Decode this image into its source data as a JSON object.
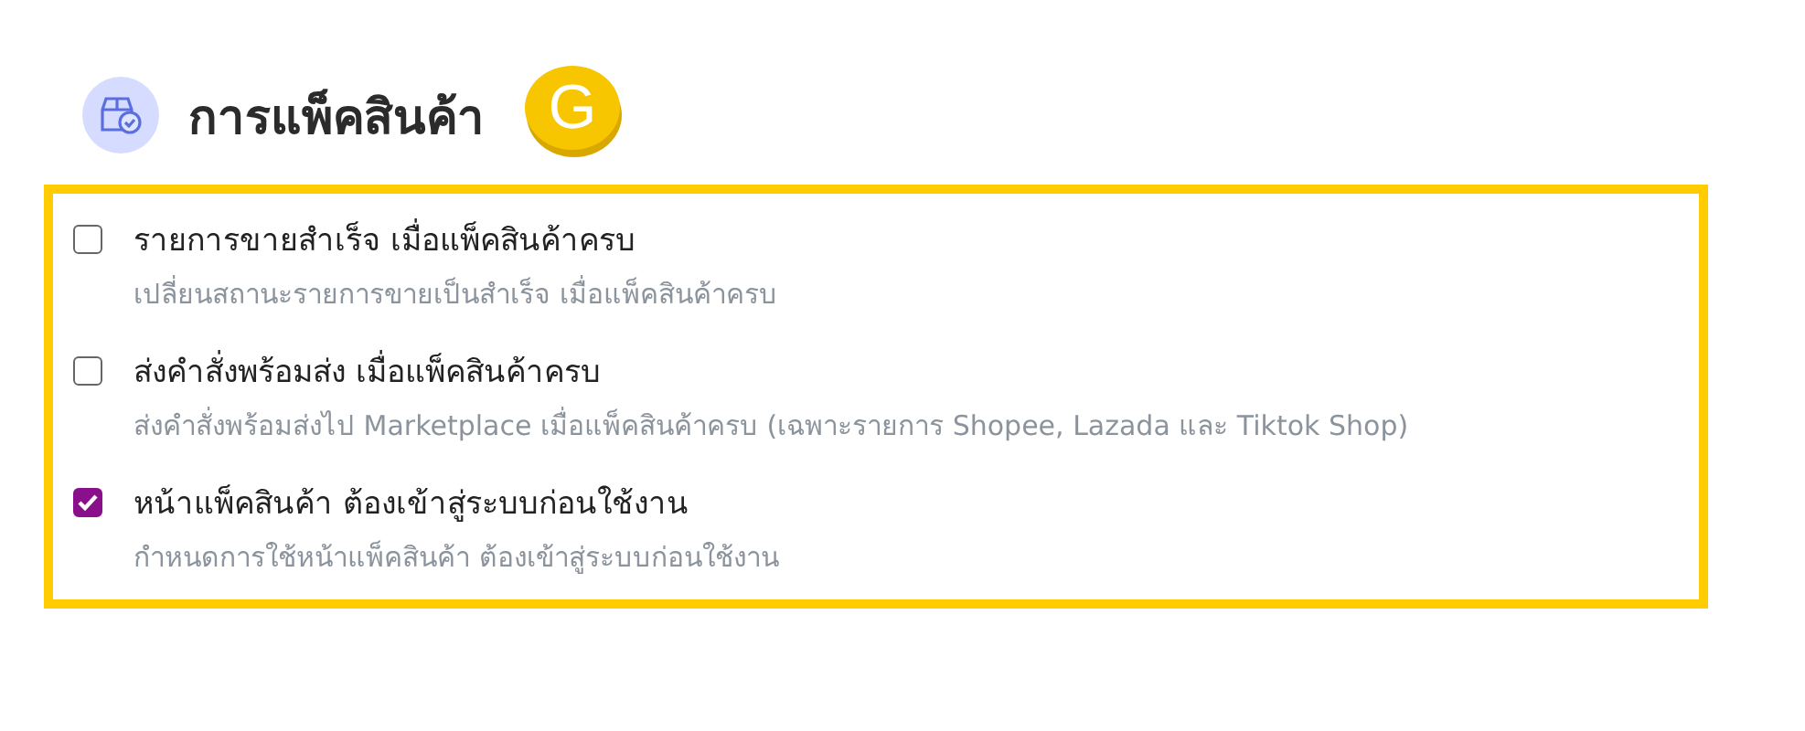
{
  "header": {
    "title": "การแพ็คสินค้า",
    "badge": "G"
  },
  "options": [
    {
      "label": "รายการขายสำเร็จ เมื่อแพ็คสินค้าครบ",
      "description": "เปลี่ยนสถานะรายการขายเป็นสำเร็จ เมื่อแพ็คสินค้าครบ",
      "checked": false
    },
    {
      "label": "ส่งคำสั่งพร้อมส่ง เมื่อแพ็คสินค้าครบ",
      "description": "ส่งคำสั่งพร้อมส่งไป Marketplace เมื่อแพ็คสินค้าครบ (เฉพาะรายการ Shopee, Lazada และ Tiktok Shop)",
      "checked": false
    },
    {
      "label": "หน้าแพ็คสินค้า ต้องเข้าสู่ระบบก่อนใช้งาน",
      "description": "กำหนดการใช้หน้าแพ็คสินค้า ต้องเข้าสู่ระบบก่อนใช้งาน",
      "checked": true
    }
  ]
}
